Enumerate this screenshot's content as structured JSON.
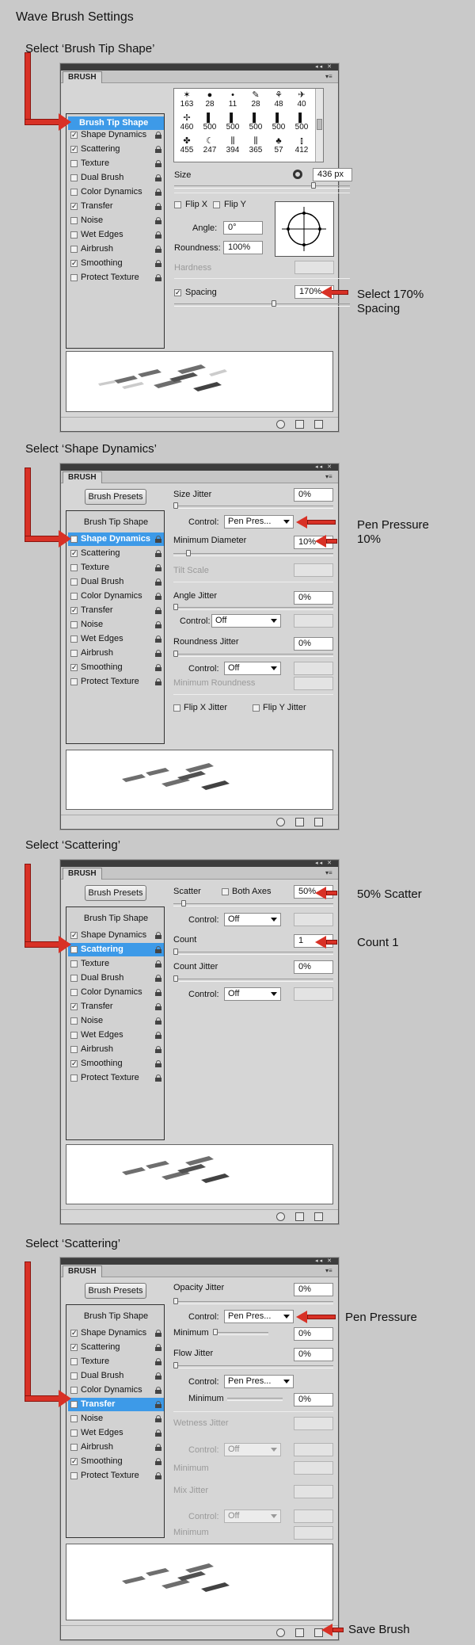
{
  "page_title": "Wave Brush Settings",
  "steps": [
    {
      "heading": "Select ‘Brush Tip Shape’"
    },
    {
      "heading": "Select ‘Shape Dynamics’"
    },
    {
      "heading": "Select ‘Scattering’"
    },
    {
      "heading": "Select ‘Scattering’"
    }
  ],
  "panel": {
    "tab_label": "BRUSH",
    "presets_button": "Brush Presets",
    "window_controls": "◂◂ ✕"
  },
  "categories": [
    "Brush Tip Shape",
    "Shape Dynamics",
    "Scattering",
    "Texture",
    "Dual Brush",
    "Color Dynamics",
    "Transfer",
    "Noise",
    "Wet Edges",
    "Airbrush",
    "Smoothing",
    "Protect Texture"
  ],
  "checked": {
    "Shape Dynamics": true,
    "Scattering": true,
    "Transfer": true,
    "Smoothing": true
  },
  "brush_tip": {
    "brush_sizes_row1": [
      "163",
      "28",
      "11",
      "28",
      "48",
      "40"
    ],
    "brush_sizes_row2": [
      "460",
      "500",
      "500",
      "500",
      "500",
      "500"
    ],
    "brush_sizes_row3": [
      "455",
      "247",
      "394",
      "365",
      "57",
      "412"
    ],
    "size_label": "Size",
    "size_value": "436 px",
    "flip_x": "Flip X",
    "flip_y": "Flip Y",
    "angle_label": "Angle:",
    "angle_value": "0°",
    "roundness_label": "Roundness:",
    "roundness_value": "100%",
    "hardness_label": "Hardness",
    "spacing_label": "Spacing",
    "spacing_value": "170%",
    "spacing_fraction": 0.57,
    "size_fraction": 0.8
  },
  "shape_dynamics": {
    "size_jitter_label": "Size Jitter",
    "size_jitter_value": "0%",
    "control_label": "Control:",
    "control_value": "Pen Pres...",
    "min_diameter_label": "Minimum Diameter",
    "min_diameter_value": "10%",
    "tilt_scale_label": "Tilt Scale",
    "angle_jitter_label": "Angle Jitter",
    "angle_jitter_value": "0%",
    "angle_control_value": "Off",
    "roundness_jitter_label": "Roundness Jitter",
    "roundness_jitter_value": "0%",
    "roundness_control_value": "Off",
    "min_roundness_label": "Minimum Roundness",
    "flip_x_jitter": "Flip X Jitter",
    "flip_y_jitter": "Flip Y Jitter"
  },
  "scattering": {
    "scatter_label": "Scatter",
    "both_axes_label": "Both Axes",
    "scatter_value": "50%",
    "control_label": "Control:",
    "control_value": "Off",
    "count_label": "Count",
    "count_value": "1",
    "count_jitter_label": "Count Jitter",
    "count_jitter_value": "0%",
    "count_jitter_control_value": "Off"
  },
  "transfer": {
    "opacity_jitter_label": "Opacity Jitter",
    "opacity_jitter_value": "0%",
    "control_label": "Control:",
    "control_value": "Pen Pres...",
    "minimum_label": "Minimum",
    "minimum_value": "0%",
    "flow_jitter_label": "Flow Jitter",
    "flow_jitter_value": "0%",
    "flow_control_value": "Pen Pres...",
    "flow_minimum_value": "0%",
    "wetness_jitter_label": "Wetness Jitter",
    "wetness_control_value": "Off",
    "mix_jitter_label": "Mix Jitter",
    "mix_control_value": "Off"
  },
  "annotations": {
    "spacing": "Select 170% Spacing",
    "pen_pressure_10": "Pen Pressure 10%",
    "scatter": "50% Scatter",
    "count": "Count 1",
    "pen_pressure": "Pen Pressure",
    "save_brush": "Save Brush"
  },
  "colors": {
    "arrow": "#d83126",
    "selection": "#3d9ae8",
    "background": "#c9c9c9",
    "panel": "#d6d6d6"
  }
}
